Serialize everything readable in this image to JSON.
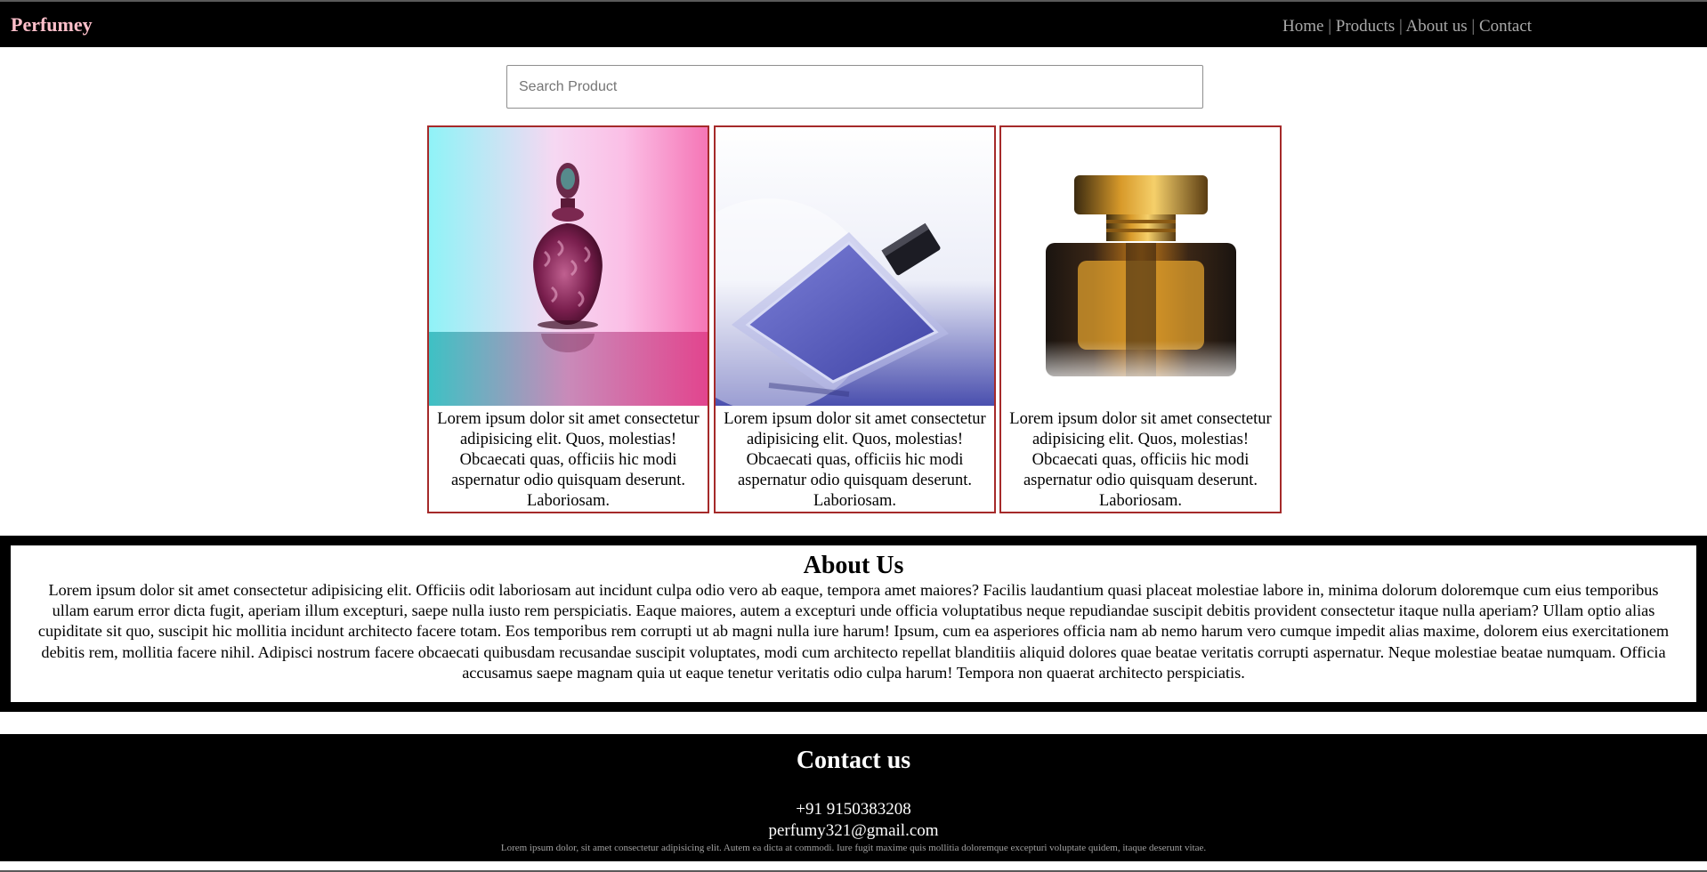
{
  "brand": {
    "name": "Perfumey",
    "color": "#ffc0cb"
  },
  "nav": {
    "links": [
      "Home",
      "Products",
      "About us",
      "Contact"
    ],
    "separator": "|"
  },
  "search": {
    "placeholder": "Search Product",
    "value": ""
  },
  "products": [
    {
      "image": "pink-teal-glass-perfume-bottle",
      "description": "Lorem ipsum dolor sit amet consectetur adipisicing elit. Quos, molestias! Obcaecati quas, officiis hic modi aspernatur odio quisquam deserunt. Laboriosam."
    },
    {
      "image": "blue-tilted-perfume-bottle",
      "description": "Lorem ipsum dolor sit amet consectetur adipisicing elit. Quos, molestias! Obcaecati quas, officiis hic modi aspernatur odio quisquam deserunt. Laboriosam."
    },
    {
      "image": "amber-perfume-bottle-gold-cap",
      "description": "Lorem ipsum dolor sit amet consectetur adipisicing elit. Quos, molestias! Obcaecati quas, officiis hic modi aspernatur odio quisquam deserunt. Laboriosam."
    }
  ],
  "about": {
    "title": "About Us",
    "text": "Lorem ipsum dolor sit amet consectetur adipisicing elit. Officiis odit laboriosam aut incidunt culpa odio vero ab eaque, tempora amet maiores? Facilis laudantium quasi placeat molestiae labore in, minima dolorum doloremque cum eius temporibus ullam earum error dicta fugit, aperiam illum excepturi, saepe nulla iusto rem perspiciatis. Eaque maiores, autem a excepturi unde officia voluptatibus neque repudiandae suscipit debitis provident consectetur itaque nulla aperiam? Ullam optio alias cupiditate sit quo, suscipit hic mollitia incidunt architecto facere totam. Eos temporibus rem corrupti ut ab magni nulla iure harum! Ipsum, cum ea asperiores officia nam ab nemo harum vero cumque impedit alias maxime, dolorem eius exercitationem debitis rem, mollitia facere nihil. Adipisci nostrum facere obcaecati quibusdam recusandae suscipit voluptates, modi cum architecto repellat blanditiis aliquid dolores quae beatae veritatis corrupti aspernatur. Neque molestiae beatae numquam. Officia accusamus saepe magnam quia ut eaque tenetur veritatis odio culpa harum! Tempora non quaerat architecto perspiciatis."
  },
  "contact": {
    "title": "Contact us",
    "phone": "+91 9150383208",
    "email": "perfumy321@gmail.com",
    "note": "Lorem ipsum dolor, sit amet consectetur adipisicing elit. Autem ea dicta at commodi. Iure fugit maxime quis mollitia doloremque excepturi voluptate quidem, itaque deserunt vitae."
  },
  "colors": {
    "navbar_bg": "#000000",
    "card_border": "#a52a2a",
    "nav_link": "#a9a9a9"
  }
}
